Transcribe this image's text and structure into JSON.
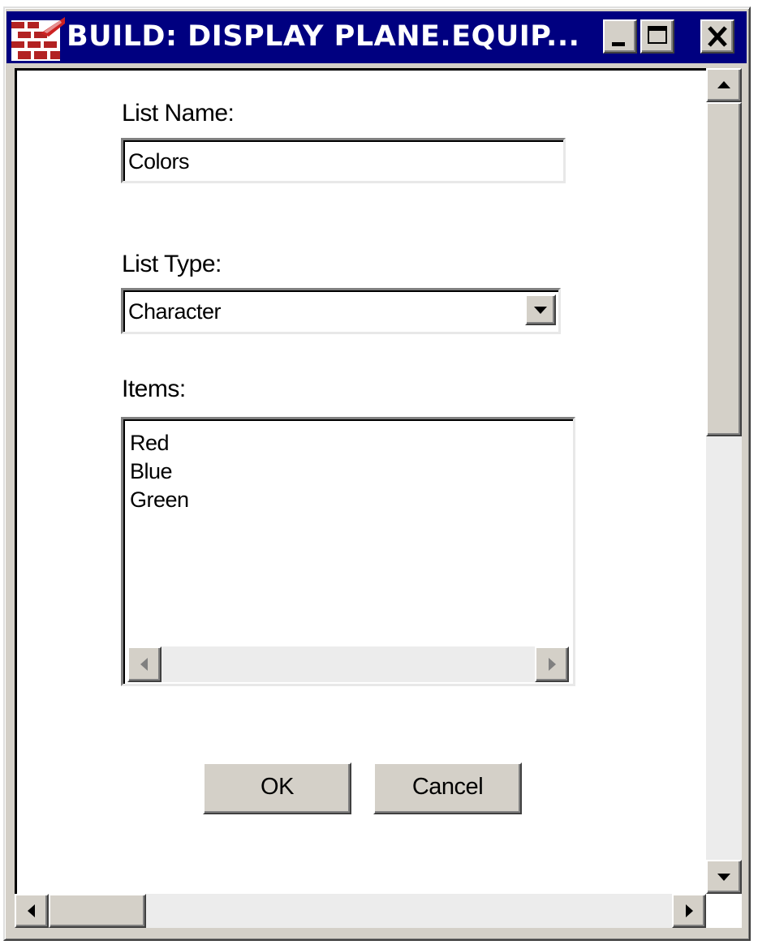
{
  "window": {
    "title": "BUILD: DISPLAY PLANE.EQUIP...",
    "icon": "brick-wall-icon",
    "controls": [
      "minimize-icon",
      "maximize-icon",
      "close-icon"
    ]
  },
  "form": {
    "list_name_label": "List Name:",
    "list_name_value": "Colors",
    "list_type_label": "List Type:",
    "list_type_value": "Character",
    "items_label": "Items:",
    "items": [
      "Red",
      "Blue",
      "Green"
    ]
  },
  "buttons": {
    "ok_label": "OK",
    "cancel_label": "Cancel"
  },
  "colors": {
    "titlebar": "#000080",
    "face": "#d4d0c8",
    "client": "#ffffff"
  }
}
